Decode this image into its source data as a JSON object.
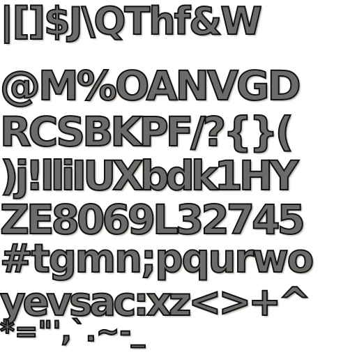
{
  "atlas": {
    "rows": [
      "|[]$J\\QThf&W",
      "@M%OANVGD",
      "RCSBKPF/?{}(",
      ")j!lliIUXbdk1HY",
      "ZE8069L32745",
      "#tgmn;pqurwo",
      "yevsac:xz<>+^",
      "*=\"',`.~-_"
    ]
  }
}
